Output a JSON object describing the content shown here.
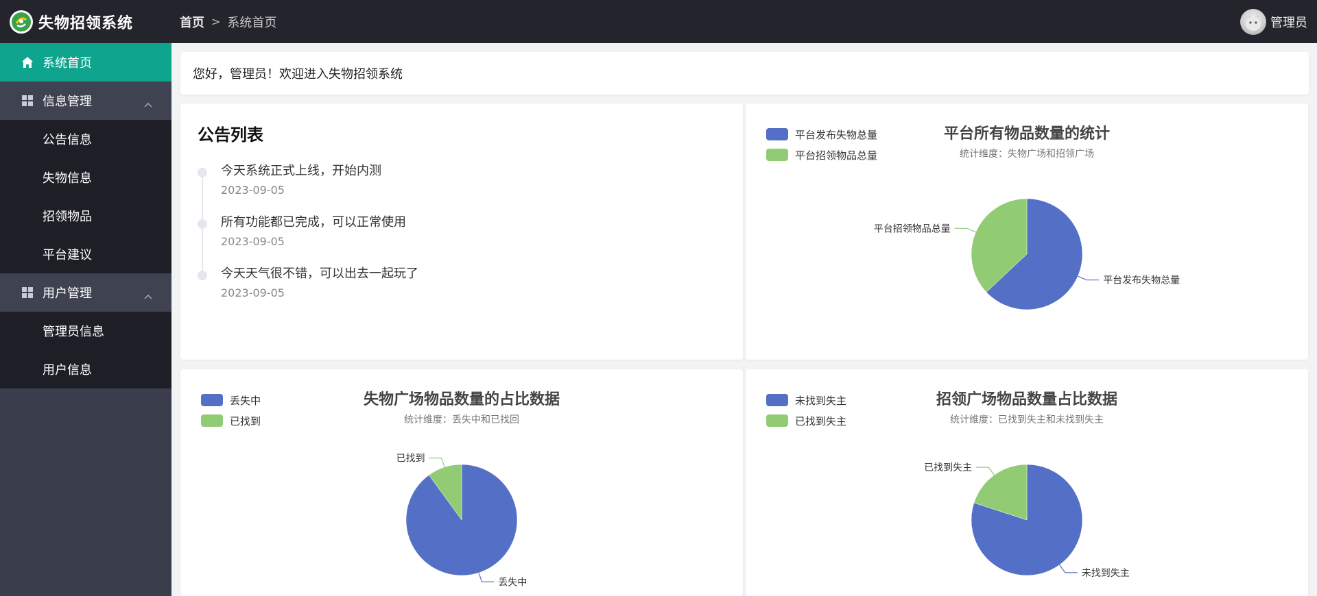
{
  "app": {
    "title": "失物招领系统"
  },
  "breadcrumb": {
    "home": "首页",
    "current": "系统首页"
  },
  "user": {
    "name": "管理员"
  },
  "sidebar": {
    "active": {
      "label": "系统首页",
      "icon": "home-icon"
    },
    "groups": [
      {
        "label": "信息管理",
        "icon": "grid-icon",
        "items": [
          "公告信息",
          "失物信息",
          "招领物品",
          "平台建议"
        ]
      },
      {
        "label": "用户管理",
        "icon": "grid-icon",
        "items": [
          "管理员信息",
          "用户信息"
        ]
      }
    ]
  },
  "welcome": {
    "text": "您好，管理员！欢迎进入失物招领系统"
  },
  "notices": {
    "title": "公告列表",
    "items": [
      {
        "text": "今天系统正式上线，开始内测",
        "date": "2023-09-05"
      },
      {
        "text": "所有功能都已完成，可以正常使用",
        "date": "2023-09-05"
      },
      {
        "text": "今天天气很不错，可以出去一起玩了",
        "date": "2023-09-05"
      }
    ]
  },
  "colors": {
    "blue": "#5470c6",
    "green": "#91cc75",
    "accent": "#0ea48e",
    "header": "#24252c",
    "sidebar": "#3a3d4b"
  },
  "chart_data": [
    {
      "type": "pie",
      "title": "平台所有物品数量的统计",
      "subtitle": "统计维度：失物广场和招领广场",
      "legend": [
        "平台发布失物总量",
        "平台招领物品总量"
      ],
      "labels": [
        "平台发布失物总量",
        "平台招领物品总量"
      ],
      "values": [
        63,
        37
      ],
      "legend_position": "top-left"
    },
    {
      "type": "pie",
      "title": "失物广场物品数量的占比数据",
      "subtitle": "统计维度：丢失中和已找回",
      "legend": [
        "丢失中",
        "已找到"
      ],
      "labels": [
        "丢失中",
        "已找到"
      ],
      "values": [
        90,
        10
      ],
      "legend_position": "top-left"
    },
    {
      "type": "pie",
      "title": "招领广场物品数量占比数据",
      "subtitle": "统计维度：已找到失主和未找到失主",
      "legend": [
        "未找到失主",
        "已找到失主"
      ],
      "labels": [
        "未找到失主",
        "已找到失主"
      ],
      "values": [
        80,
        20
      ],
      "legend_position": "top-left"
    }
  ]
}
